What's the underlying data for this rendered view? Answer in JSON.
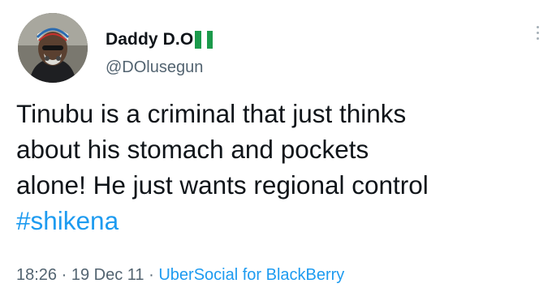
{
  "user": {
    "display_name": "Daddy D.O",
    "handle": "@DOlusegun",
    "flag_icon": "nigeria-flag-icon",
    "avatar_icon": "profile-avatar"
  },
  "tweet": {
    "lines": [
      "Tinubu is a criminal that just thinks",
      "about his stomach and pockets",
      "alone! He just wants regional control"
    ],
    "hashtag": "#shikena"
  },
  "meta": {
    "time": "18:26",
    "sep1": "·",
    "date": "19 Dec 11",
    "sep2": "·",
    "source": "UberSocial for BlackBerry"
  },
  "colors": {
    "text": "#0f1419",
    "secondary": "#536471",
    "link": "#1d9bf0",
    "flag_green": "#1b9a4b"
  }
}
